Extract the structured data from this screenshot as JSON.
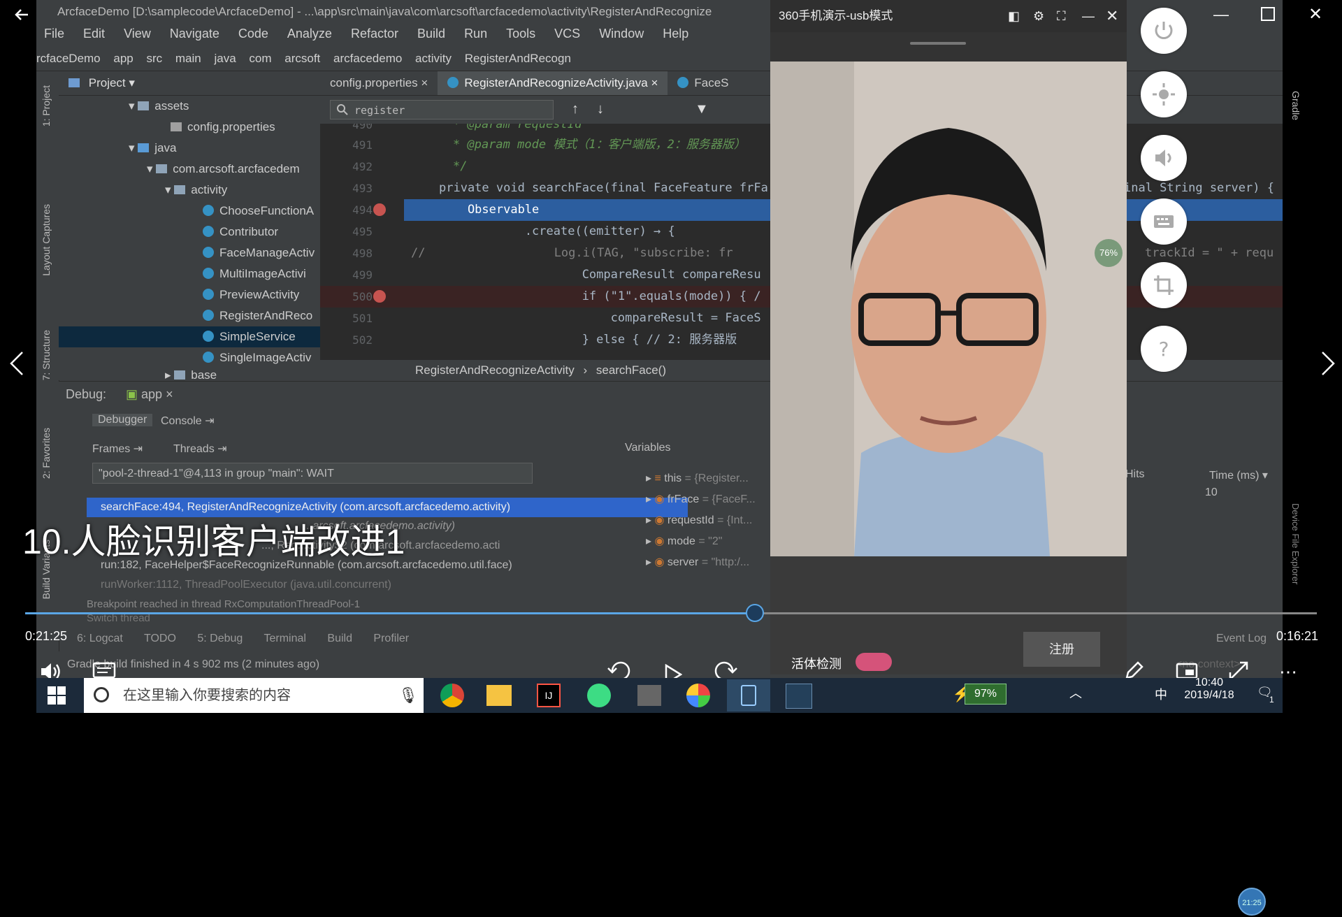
{
  "window": {
    "title": "ArcfaceDemo [D:\\samplecode\\ArcfaceDemo] - ...\\app\\src\\main\\java\\com\\arcsoft\\arcfacedemo\\activity\\RegisterAndRecognize"
  },
  "menu": [
    "File",
    "Edit",
    "View",
    "Navigate",
    "Code",
    "Analyze",
    "Refactor",
    "Build",
    "Run",
    "Tools",
    "VCS",
    "Window",
    "Help"
  ],
  "nav": [
    "rcfaceDemo",
    "app",
    "src",
    "main",
    "java",
    "com",
    "arcsoft",
    "arcfacedemo",
    "activity",
    "RegisterAndRecogn"
  ],
  "project": {
    "header": "Project",
    "tree": [
      "assets",
      "config.properties",
      "java",
      "com.arcsoft.arcfacedem",
      "activity",
      "ChooseFunctionA",
      "Contributor",
      "FaceManageActiv",
      "MultiImageActivi",
      "PreviewActivity",
      "RegisterAndReco",
      "SimpleService",
      "SingleImageActiv",
      "base"
    ]
  },
  "side_labels": {
    "project": "1: Project",
    "captures": "Layout Captures",
    "structure": "7: Structure",
    "favorites": "2: Favorites",
    "variants": "Build Variants",
    "gradle": "Gradle",
    "device": "Device File Explorer"
  },
  "tabs": [
    "config.properties",
    "RegisterAndRecognizeActivity.java",
    "FaceS"
  ],
  "search": {
    "value": "register"
  },
  "code_lines": [
    {
      "n": "490",
      "t": "* @param requestId"
    },
    {
      "n": "491",
      "t": "* @param mode 模式（1：客户端版，2：服务器版）"
    },
    {
      "n": "492",
      "t": "*/"
    },
    {
      "n": "493",
      "t": "private void searchFace(final FaceFeature frFa"
    },
    {
      "n": "494",
      "t": "    Observable"
    },
    {
      "n": "495",
      "t": "            .create((emitter) → {"
    },
    {
      "n": "498",
      "t": "//                  Log.i(TAG, \"subscribe: fr"
    },
    {
      "n": "499",
      "t": "                    CompareResult compareResu"
    },
    {
      "n": "500",
      "t": "                    if (\"1\".equals(mode)) { /"
    },
    {
      "n": "501",
      "t": "                        compareResult = FaceS"
    },
    {
      "n": "502",
      "t": "                    } else { // 2: 服务器版"
    }
  ],
  "code_right": {
    "line493": "inal String server) {",
    "line498": "trackId = \" + requ"
  },
  "breadcrumb": [
    "RegisterAndRecognizeActivity",
    "searchFace()"
  ],
  "debug": {
    "label": "Debug:",
    "config": "app",
    "tabs": [
      "Debugger",
      "Console"
    ],
    "frames": "Frames",
    "threads": "Threads",
    "thread_select": "\"pool-2-thread-1\"@4,113 in group \"main\": WAIT",
    "stack": [
      "searchFace:494, RegisterAndRecognizeActivity (com.arcsoft.arcfacedemo.activity)",
      "...arcsoft.arcfacedemo.activity)",
      "..., Reg...ctivity$2 (com.arcsoft.arcfacedemo.acti",
      "run:182, FaceHelper$FaceRecognizeRunnable (com.arcsoft.arcfacedemo.util.face)",
      "runWorker:1112, ThreadPoolExecutor (java.util.concurrent)"
    ],
    "breakpoint_msg": "Breakpoint reached in thread RxComputationThreadPool-1",
    "switch": "Switch thread",
    "variables_header": "Variables",
    "variables": [
      {
        "name": "this",
        "val": "= {Register..."
      },
      {
        "name": "frFace",
        "val": "= {FaceF..."
      },
      {
        "name": "requestId",
        "val": "= {Int..."
      },
      {
        "name": "mode",
        "val": "= \"2\""
      },
      {
        "name": "server",
        "val": "= \"http:/..."
      }
    ],
    "hits": "Hits",
    "time_ms": "Time (ms)",
    "time_val": "10"
  },
  "bottom_tabs": [
    "6: Logcat",
    "TODO",
    "5: Debug",
    "Terminal",
    "Build",
    "Profiler",
    "Event Log"
  ],
  "status": "Gradle build finished in 4 s 902 ms (2 minutes ago)",
  "context": "<no context>",
  "phone": {
    "title": "360手机演示-usb模式",
    "liveness": "活体检测",
    "register": "注册",
    "battery_pct": "76%",
    "time_badge": "21:25"
  },
  "player": {
    "title": "10.人脸识别客户端改进1",
    "current": "0:21:25",
    "total": "0:16:21",
    "progress": 0.565,
    "rewind": "10",
    "forward": "30"
  },
  "taskbar": {
    "search_placeholder": "在这里输入你要搜索的内容",
    "battery": "97%",
    "ime": "中",
    "clock_time": "10:40",
    "clock_date": "2019/4/18",
    "notify": "1"
  }
}
